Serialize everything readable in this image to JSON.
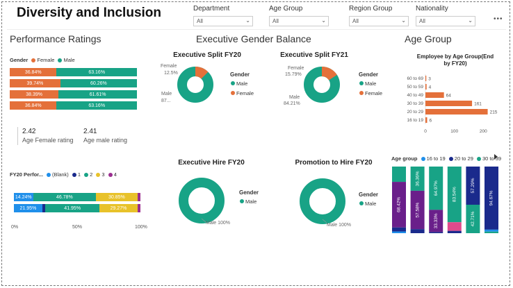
{
  "title": "Diversity and Inclusion",
  "colors": {
    "female": "#e4703a",
    "male": "#18a386",
    "blank": "#1f8fea",
    "r1": "#1a2a8c",
    "r2": "#18a386",
    "r3": "#e8c22a",
    "r4": "#9b2e90",
    "age_16_19": "#1f8fea",
    "age_20_29": "#1a2a8c",
    "age_30_39": "#18a386",
    "age_40_49": "#6a1f8a",
    "age_other": "#e04a8c"
  },
  "filters": [
    {
      "label": "Department",
      "value": "All"
    },
    {
      "label": "Age Group",
      "value": "All"
    },
    {
      "label": "Region Group",
      "value": "All"
    },
    {
      "label": "Nationality",
      "value": "All"
    }
  ],
  "more_icon": "•••",
  "sections": {
    "performance": "Performance Ratings",
    "gender": "Executive Gender Balance",
    "age": "Age Group"
  },
  "perf_gender": {
    "legend_title": "Gender",
    "legend": [
      "Female",
      "Male"
    ],
    "rows": [
      {
        "female": "36.84%",
        "male": "63.16%",
        "f": 36.84
      },
      {
        "female": "39.74%",
        "male": "60.26%",
        "f": 39.74
      },
      {
        "female": "38.39%",
        "male": "61.61%",
        "f": 38.39
      },
      {
        "female": "36.84%",
        "male": "63.16%",
        "f": 36.84
      }
    ]
  },
  "kpis": [
    {
      "value": "2.42",
      "label": "Age Female rating"
    },
    {
      "value": "2.41",
      "label": "Age male rating"
    }
  ],
  "fy20_perf": {
    "legend_title": "FY20 Perfor...",
    "legend": [
      "(Blank)",
      "1",
      "2",
      "3",
      "4"
    ],
    "rows": [
      {
        "blank": 14.24,
        "r1": 0,
        "r2": 46.78,
        "r3": 30.85,
        "r4": 2.2,
        "labels": [
          "14.24%",
          "",
          "46.78%",
          "30.85%",
          ""
        ]
      },
      {
        "blank": 21.95,
        "r1": 2.3,
        "r2": 41.95,
        "r3": 29.27,
        "r4": 2.3,
        "labels": [
          "21.95%",
          "",
          "41.95%",
          "29.27%",
          ""
        ]
      }
    ],
    "axis": [
      "0%",
      "50%",
      "100%"
    ]
  },
  "donuts": {
    "split20": {
      "title": "Executive Split FY20",
      "female_label": "Female",
      "female_pct": "12.5%",
      "male_label": "Male",
      "male_pct": "87...",
      "female": 12.5,
      "legend_title": "Gender",
      "legend": [
        "Male",
        "Female"
      ]
    },
    "split21": {
      "title": "Executive Split FY21",
      "female_label": "Female",
      "female_pct": "15.79%",
      "male_label": "Male",
      "male_pct": "84.21%",
      "female": 15.79,
      "legend_title": "Gender",
      "legend": [
        "Male",
        "Female"
      ]
    },
    "hire20": {
      "title": "Executive Hire FY20",
      "label": "Male 100%",
      "legend_title": "Gender",
      "legend": [
        "Male"
      ]
    },
    "promo20": {
      "title": "Promotion to Hire FY20",
      "label": "Male 100%",
      "legend_title": "Gender",
      "legend": [
        "Male"
      ]
    }
  },
  "chart_data": [
    {
      "type": "bar",
      "title": "Employee by Age Group(End by FY20)",
      "categories": [
        "60 to 69",
        "50 to 59",
        "40 to 49",
        "30 to 39",
        "20 to 29",
        "16 to 19"
      ],
      "values": [
        3,
        4,
        64,
        161,
        215,
        6
      ],
      "value_labels": [
        "3",
        "4",
        "64",
        "161",
        "215",
        "6"
      ],
      "xlim": [
        0,
        240
      ],
      "xticks": [
        "0",
        "100",
        "200"
      ]
    },
    {
      "type": "bar",
      "title": "Age group",
      "legend": [
        "16 to 19",
        "20 to 29",
        "30 to 39"
      ],
      "columns": [
        {
          "segments": [
            {
              "c": "age_30_39",
              "v": 23
            },
            {
              "c": "age_40_49",
              "v": 68.42,
              "label": "68.42%"
            },
            {
              "c": "age_20_29",
              "v": 6
            },
            {
              "c": "age_16_19",
              "v": 2.58
            }
          ]
        },
        {
          "segments": [
            {
              "c": "age_30_39",
              "v": 36.36,
              "label": "36.36%"
            },
            {
              "c": "age_40_49",
              "v": 57.58,
              "label": "57.58%"
            },
            {
              "c": "age_20_29",
              "v": 6.06
            }
          ]
        },
        {
          "segments": [
            {
              "c": "age_30_39",
              "v": 64.97,
              "label": "64.97%"
            },
            {
              "c": "age_40_49",
              "v": 33.33,
              "label": "33.33%"
            },
            {
              "c": "age_20_29",
              "v": 1.7
            }
          ]
        },
        {
          "segments": [
            {
              "c": "age_30_39",
              "v": 83.54,
              "label": "83.54%"
            },
            {
              "c": "age_other",
              "v": 13
            },
            {
              "c": "age_20_29",
              "v": 3.46
            }
          ]
        },
        {
          "segments": [
            {
              "c": "age_20_29",
              "v": 57.29,
              "label": "57.29%"
            },
            {
              "c": "age_30_39",
              "v": 42.71,
              "label": "42.71%"
            }
          ]
        },
        {
          "segments": [
            {
              "c": "age_20_29",
              "v": 94.67,
              "label": "94.67%"
            },
            {
              "c": "age_16_19",
              "v": 3
            },
            {
              "c": "age_30_39",
              "v": 2.33
            }
          ]
        }
      ]
    }
  ]
}
